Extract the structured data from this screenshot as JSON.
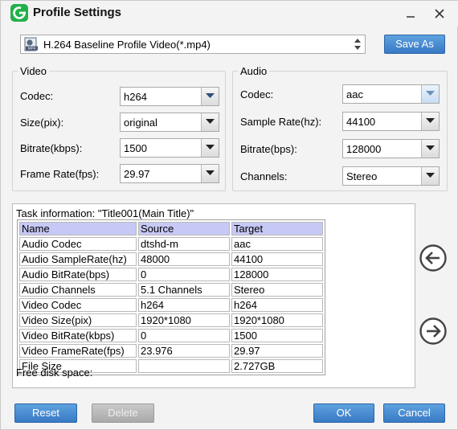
{
  "window": {
    "title": "Profile Settings"
  },
  "icons": {
    "app": "app-logo-icon",
    "minimize": "minimize-icon",
    "close": "close-icon",
    "profile": "mp4-file-icon",
    "left_arrow": "arrow-left-icon",
    "right_arrow": "arrow-right-icon"
  },
  "colors": {
    "accent": "#3a7cc6",
    "header_row": "#c6c8f5",
    "logo": "#22b04a"
  },
  "profile": {
    "selected": "H.264 Baseline Profile Video(*.mp4)",
    "icon_text": "MP4",
    "save_as": "Save As"
  },
  "video": {
    "group_label": "Video",
    "codec_label": "Codec:",
    "codec_value": "h264",
    "size_label": "Size(pix):",
    "size_value": "original",
    "bitrate_label": "Bitrate(kbps):",
    "bitrate_value": "1500",
    "framerate_label": "Frame Rate(fps):",
    "framerate_value": "29.97"
  },
  "audio": {
    "group_label": "Audio",
    "codec_label": "Codec:",
    "codec_value": "aac",
    "samplerate_label": "Sample Rate(hz):",
    "samplerate_value": "44100",
    "bitrate_label": "Bitrate(bps):",
    "bitrate_value": "128000",
    "channels_label": "Channels:",
    "channels_value": "Stereo"
  },
  "task": {
    "title": "Task information: \"Title001(Main Title)\"",
    "columns": [
      "Name",
      "Source",
      "Target"
    ],
    "rows": [
      [
        "Audio Codec",
        "dtshd-m",
        "aac"
      ],
      [
        "Audio SampleRate(hz)",
        "48000",
        "44100"
      ],
      [
        "Audio BitRate(bps)",
        "0",
        "128000"
      ],
      [
        "Audio Channels",
        "5.1 Channels",
        "Stereo"
      ],
      [
        "Video Codec",
        "h264",
        "h264"
      ],
      [
        "Video Size(pix)",
        "1920*1080",
        "1920*1080"
      ],
      [
        "Video BitRate(kbps)",
        "0",
        "1500"
      ],
      [
        "Video FrameRate(fps)",
        "23.976",
        "29.97"
      ],
      [
        "File Size",
        "",
        "2.727GB"
      ]
    ],
    "free_disk": "Free disk space:"
  },
  "buttons": {
    "reset": "Reset",
    "delete": "Delete",
    "ok": "OK",
    "cancel": "Cancel"
  }
}
